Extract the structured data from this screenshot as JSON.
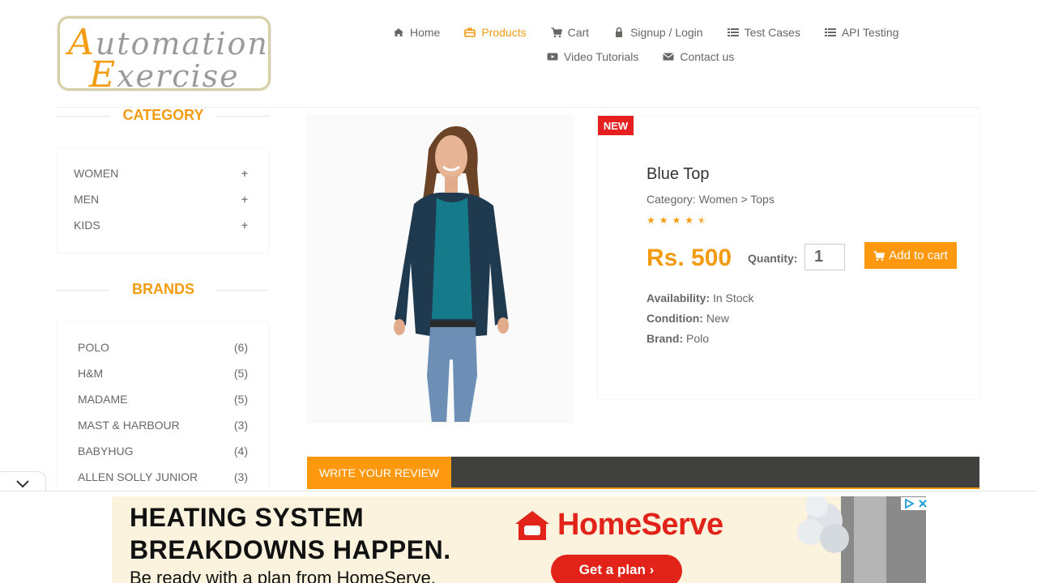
{
  "logo": {
    "line1_cap": "A",
    "line1_rest": "utomation",
    "line2_cap": "E",
    "line2_rest": "xercise"
  },
  "nav": [
    {
      "label": "Home",
      "icon": "home-icon"
    },
    {
      "label": "Products",
      "icon": "briefcase-icon",
      "active": true
    },
    {
      "label": "Cart",
      "icon": "cart-icon"
    },
    {
      "label": "Signup / Login",
      "icon": "lock-icon"
    },
    {
      "label": "Test Cases",
      "icon": "list-icon"
    },
    {
      "label": "API Testing",
      "icon": "list-icon"
    },
    {
      "label": "Video Tutorials",
      "icon": "youtube-icon"
    },
    {
      "label": "Contact us",
      "icon": "envelope-icon"
    }
  ],
  "sidebar": {
    "category_title": "CATEGORY",
    "categories": [
      {
        "label": "WOMEN",
        "toggle": "+"
      },
      {
        "label": "MEN",
        "toggle": "+"
      },
      {
        "label": "KIDS",
        "toggle": "+"
      }
    ],
    "brands_title": "BRANDS",
    "brands": [
      {
        "name": "POLO",
        "count": "(6)"
      },
      {
        "name": "H&M",
        "count": "(5)"
      },
      {
        "name": "MADAME",
        "count": "(5)"
      },
      {
        "name": "MAST & HARBOUR",
        "count": "(3)"
      },
      {
        "name": "BABYHUG",
        "count": "(4)"
      },
      {
        "name": "ALLEN SOLLY JUNIOR",
        "count": "(3)"
      }
    ]
  },
  "product": {
    "badge": "NEW",
    "name": "Blue Top",
    "category": "Category: Women > Tops",
    "rating": 4.5,
    "price": "Rs. 500",
    "quantity_label": "Quantity:",
    "quantity_value": "1",
    "add_to_cart": "Add to cart",
    "availability_label": "Availability:",
    "availability_value": "In Stock",
    "condition_label": "Condition:",
    "condition_value": "New",
    "brand_label": "Brand:",
    "brand_value": "Polo"
  },
  "review": {
    "tab_label": "WRITE YOUR REVIEW"
  },
  "ad": {
    "line1": "HEATING SYSTEM",
    "line2": "BREAKDOWNS HAPPEN.",
    "line3": "Be ready with a plan from HomeServe.",
    "brand": "HomeServe",
    "cta": "Get a plan ›",
    "brand_color": "#e2231a"
  },
  "colors": {
    "accent": "#fe980f",
    "title_orange": "#f39c12",
    "new_badge": "#e62020",
    "tab_bar": "#40403e"
  }
}
